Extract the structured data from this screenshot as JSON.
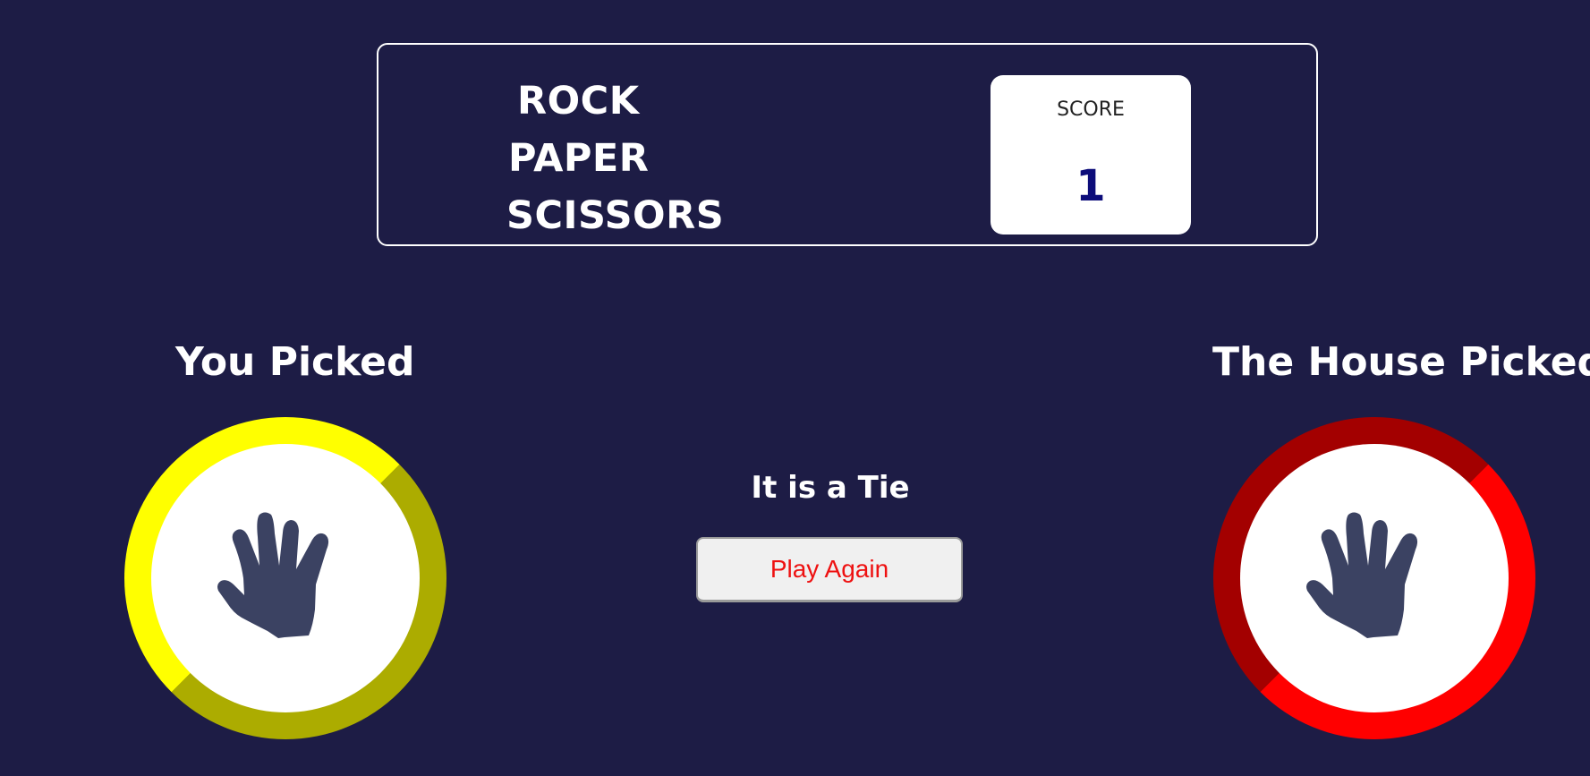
{
  "header": {
    "title_lines": [
      "ROCK",
      "PAPER",
      "SCISSORS"
    ],
    "score_label": "SCORE",
    "score_value": "1"
  },
  "player": {
    "label": "You Picked",
    "choice_icon": "paper-hand-icon",
    "ring_color": "#ffff00"
  },
  "house": {
    "label": "The House Picked",
    "choice_icon": "paper-hand-icon",
    "ring_color": "#ff0000"
  },
  "result": {
    "message": "It is a Tie",
    "play_again_label": "Play Again"
  },
  "colors": {
    "background": "#1d1c45",
    "hand": "#3b4262",
    "score_value": "#0c0c7a",
    "play_again_text": "#ee1111"
  }
}
